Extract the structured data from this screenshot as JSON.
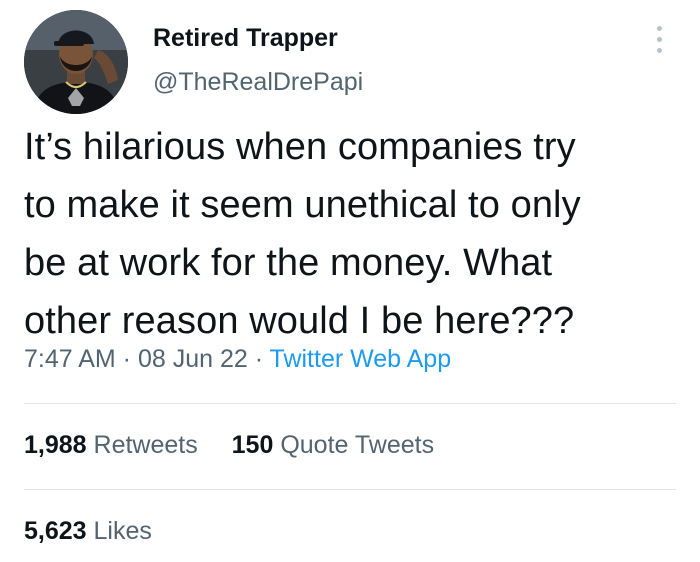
{
  "user": {
    "display_name": "Retired Trapper",
    "handle": "@TheRealDrePapi"
  },
  "tweet": {
    "text": "It’s hilarious when companies try\nto make it seem unethical to only\nbe at work for the money. What\nother reason would I be here???",
    "time": "7:47 AM",
    "separator": " · ",
    "date": "08 Jun 22",
    "source": "Twitter Web App"
  },
  "stats": {
    "retweets_count": "1,988",
    "retweets_label": "Retweets",
    "quotes_count": "150",
    "quotes_label": "Quote Tweets",
    "likes_count": "5,623",
    "likes_label": "Likes"
  },
  "colors": {
    "text": "#0f1419",
    "secondary": "#536471",
    "link": "#1d9bf0",
    "divider": "#e1e6ea"
  },
  "icons": {
    "more": "more-horizontal-icon",
    "avatar": "profile-avatar"
  }
}
